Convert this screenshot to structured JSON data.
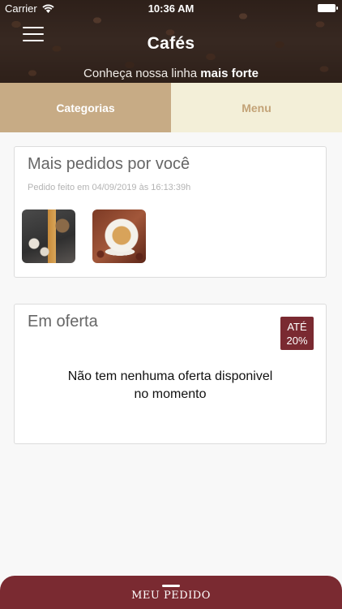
{
  "status_bar": {
    "carrier": "Carrier",
    "time": "10:36 AM"
  },
  "header": {
    "title": "Cafés",
    "subtitle_prefix": "Conheça nossa linha ",
    "subtitle_bold": "mais forte"
  },
  "tabs": [
    {
      "label": "Categorias",
      "active": true
    },
    {
      "label": "Menu",
      "active": false
    }
  ],
  "recent": {
    "title": "Mais pedidos por você",
    "subtitle": "Pedido feito em 04/09/2019 às 16:13:39h",
    "items": [
      "coffee-pot-product-image",
      "coffee-cup-product-image"
    ]
  },
  "offers": {
    "title": "Em oferta",
    "badge_line1": "ATÉ",
    "badge_line2": "20%",
    "empty_line1": "Não tem nenhuma oferta disponivel",
    "empty_line2": "no momento"
  },
  "bottom_bar": {
    "label": "MEU PEDIDO"
  },
  "colors": {
    "accent": "#7a2a31",
    "tab_active": "#c7ab85",
    "tab_inactive": "#f3efd8",
    "tab_inactive_text": "#c3a377"
  }
}
